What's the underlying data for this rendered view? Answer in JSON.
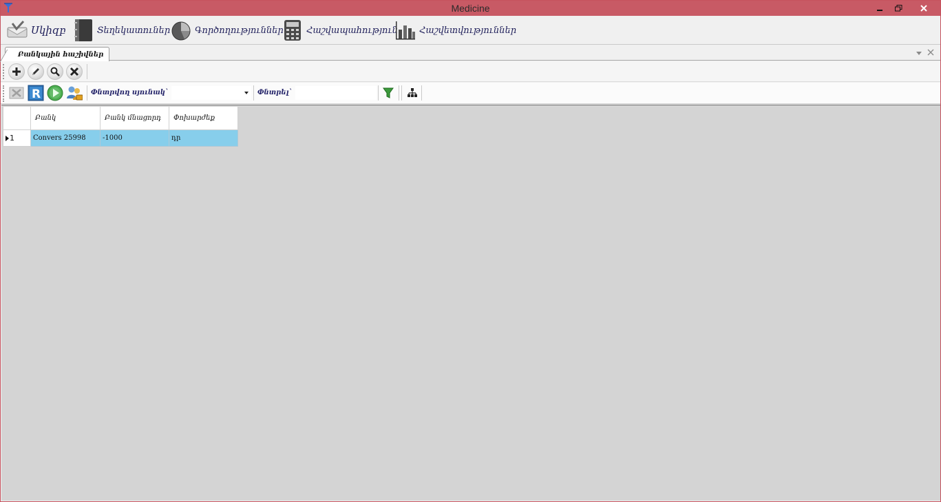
{
  "window": {
    "title": "Medicine",
    "accent": "#c85a65"
  },
  "menu": {
    "items": [
      {
        "label": "Սկիզբ",
        "icon": "checkbox-tray-icon"
      },
      {
        "label": "Տեղեկատուներ",
        "icon": "binder-book-icon"
      },
      {
        "label": "Գործողություններ",
        "icon": "pie-chart-icon"
      },
      {
        "label": "Հաշվապահություն",
        "icon": "calculator-icon"
      },
      {
        "label": "Հաշվետվություններ",
        "icon": "bar-chart-icon"
      }
    ]
  },
  "tabs": {
    "active_label": "Բանկային հաշիվներ"
  },
  "toolbar2": {
    "filter_column_label": "Փնտրվող սյունակ`",
    "filter_column_value": "",
    "search_label": "Փնտրել`",
    "search_value": ""
  },
  "grid": {
    "columns": [
      "Բանկ",
      "Բանկ մնացորդ",
      "Փոխարժեք"
    ],
    "rows": [
      {
        "number": "1",
        "cells": [
          "Convers 25998",
          "-1000",
          "դր"
        ]
      }
    ],
    "selected_row_color": "#87ceeb"
  }
}
